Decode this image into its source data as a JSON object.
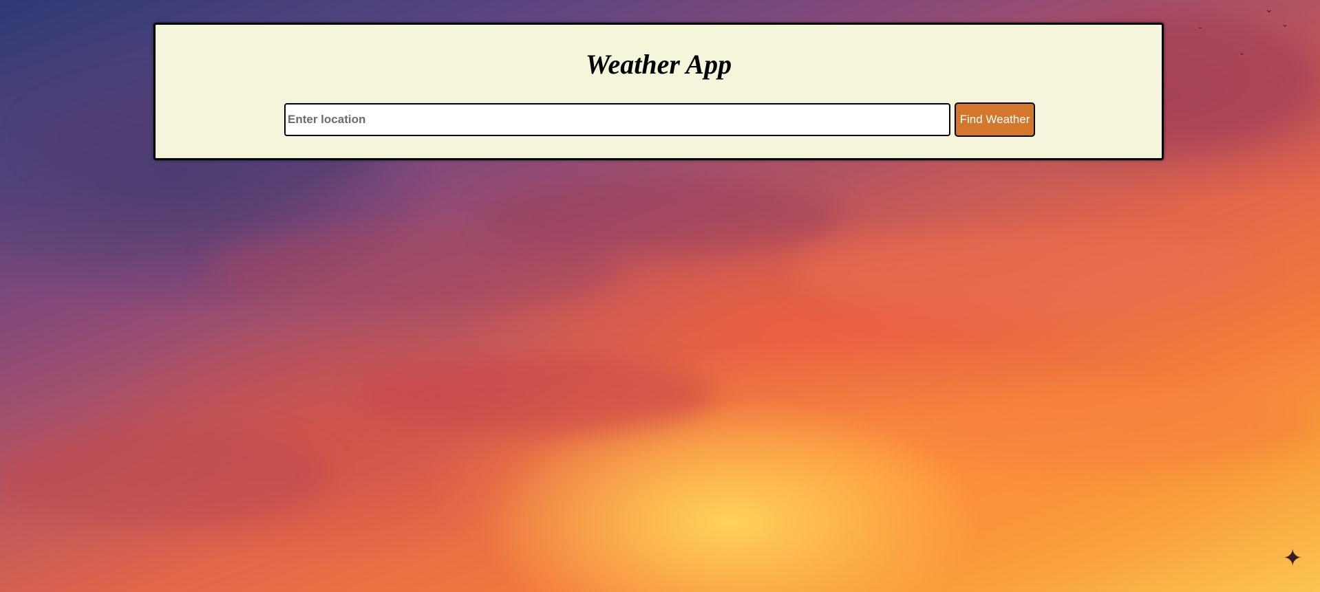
{
  "app": {
    "title": "Weather App"
  },
  "search": {
    "placeholder": "Enter location",
    "value": "",
    "button_label": "Find Weather"
  },
  "theme": {
    "panel_background": "#f5f5dc",
    "button_color": "#d2772c",
    "button_text_color": "#ffffff"
  },
  "background": {
    "image": "sunset-sky"
  }
}
